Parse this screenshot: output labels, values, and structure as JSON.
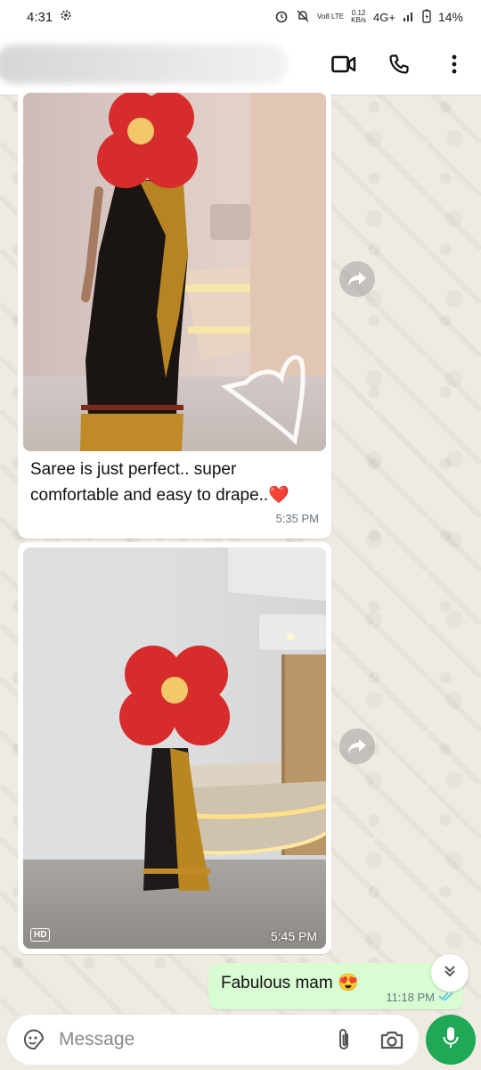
{
  "status_bar": {
    "time": "4:31",
    "network_speed_top": "0.12",
    "network_speed_bottom": "KB/s",
    "lte_label": "Vo8 LTE",
    "signal": "4G+",
    "battery": "14%"
  },
  "header": {
    "contact_name_blurred": true,
    "icons": [
      "video-call-icon",
      "phone-icon",
      "more-options-icon"
    ]
  },
  "messages": [
    {
      "direction": "incoming",
      "type": "image",
      "caption": "Saree is just perfect.. super comfortable and easy to drape..❤️",
      "time": "5:35 PM"
    },
    {
      "direction": "incoming",
      "type": "image",
      "hd_badge": "HD",
      "time": "5:45 PM"
    },
    {
      "direction": "outgoing",
      "type": "text",
      "text": "Fabulous mam 😍",
      "time": "11:18 PM",
      "status": "read"
    }
  ],
  "composer": {
    "placeholder": "Message"
  },
  "colors": {
    "accent": "#1fa855",
    "outgoing_bubble": "#d9fdd3",
    "read_ticks": "#53bdeb",
    "wallpaper": "#efeae2"
  }
}
